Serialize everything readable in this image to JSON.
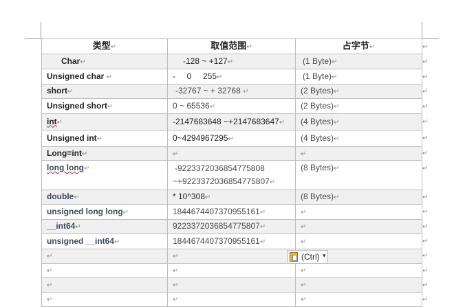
{
  "mark": "↵",
  "header": [
    "类型",
    "取值范围",
    "占字节"
  ],
  "rows": [
    {
      "type": "Char",
      "range": "-128 ~ +127",
      "bytes": "(1 Byte)"
    },
    {
      "type": "Unsigned char",
      "range": "-     0     255",
      "bytes": "(1 Byte)"
    },
    {
      "type": "short",
      "range": "-32767 ~ + 32768",
      "bytes": "(2 Bytes)"
    },
    {
      "type": "Unsigned short",
      "range": "0 ~ 65536",
      "bytes": "(2 Bytes)"
    },
    {
      "type": "int",
      "range": "-2147683648 ~+2147683647",
      "bytes": "(4 Bytes)"
    },
    {
      "type": "Unsigned int",
      "range": "0~4294967295",
      "bytes": "(4 Bytes)"
    },
    {
      "type": "Long=int",
      "range": "",
      "bytes": ""
    },
    {
      "type": "long long",
      "range_line1": "-9223372036854775808",
      "range_line2": "~+9223372036854775807",
      "bytes": "(8 Bytes)"
    },
    {
      "type": "double",
      "range": "* 10^308",
      "bytes": "(8 Bytes)"
    },
    {
      "type": "unsigned long long",
      "range": "1844674407370955161",
      "bytes": ""
    },
    {
      "type": "__int64",
      "range": "9223372036854775807",
      "bytes": ""
    },
    {
      "type": "unsigned __int64",
      "range": "1844674407370955161",
      "bytes": ""
    }
  ],
  "paste_button": {
    "label": "(Ctrl)",
    "arrow": "▾"
  }
}
